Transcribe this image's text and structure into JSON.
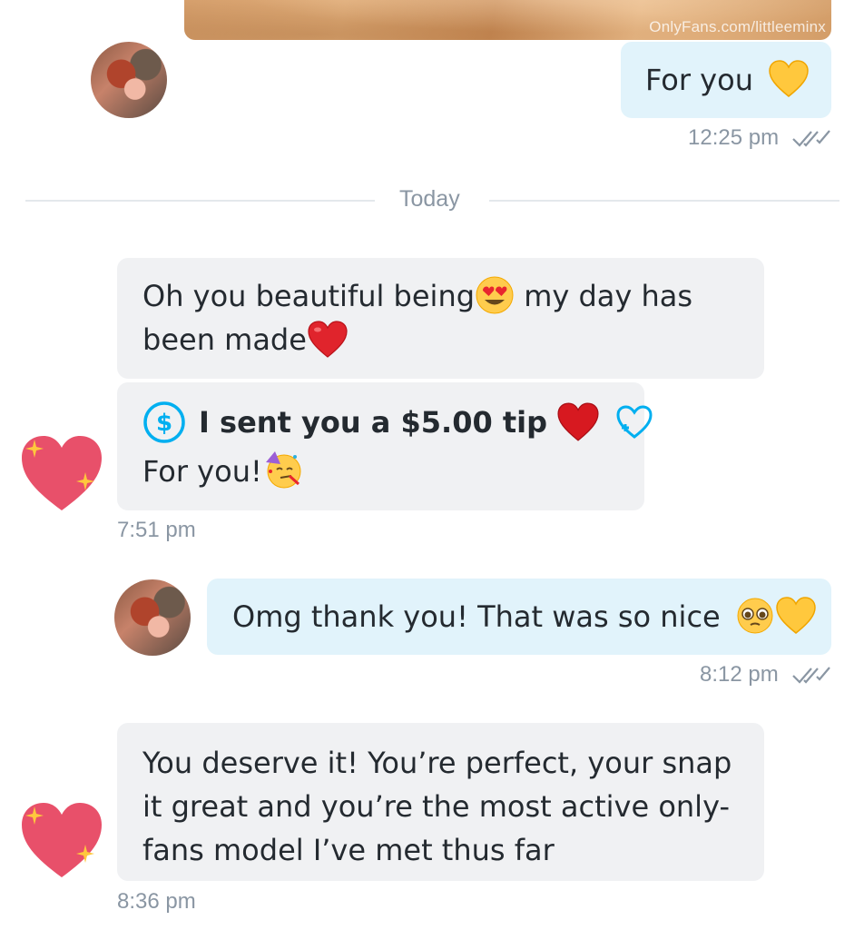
{
  "media": {
    "watermark": "OnlyFans.com/littleeminx"
  },
  "messages": [
    {
      "text": "For you",
      "time": "12:25 pm"
    },
    {
      "text_part1": "Oh you beautiful being",
      "text_part2": " my day has",
      "text_part3": "been made"
    },
    {
      "tip_text": "I sent you a $5.00 tip",
      "text": "For you!",
      "time": "7:51 pm"
    },
    {
      "text": "Omg thank you! That was so nice",
      "time": "8:12 pm"
    },
    {
      "line1": "You deserve it! You’re perfect, your snap",
      "line2": "it great and you’re the most active only-",
      "line3": "fans model I’ve met thus far",
      "time": "8:36 pm"
    }
  ],
  "divider": {
    "label": "Today"
  },
  "colors": {
    "outgoing_bubble": "#e1f3fb",
    "incoming_bubble": "#f0f1f3",
    "accent": "#00aff0",
    "timestamp": "#8a96a3"
  }
}
